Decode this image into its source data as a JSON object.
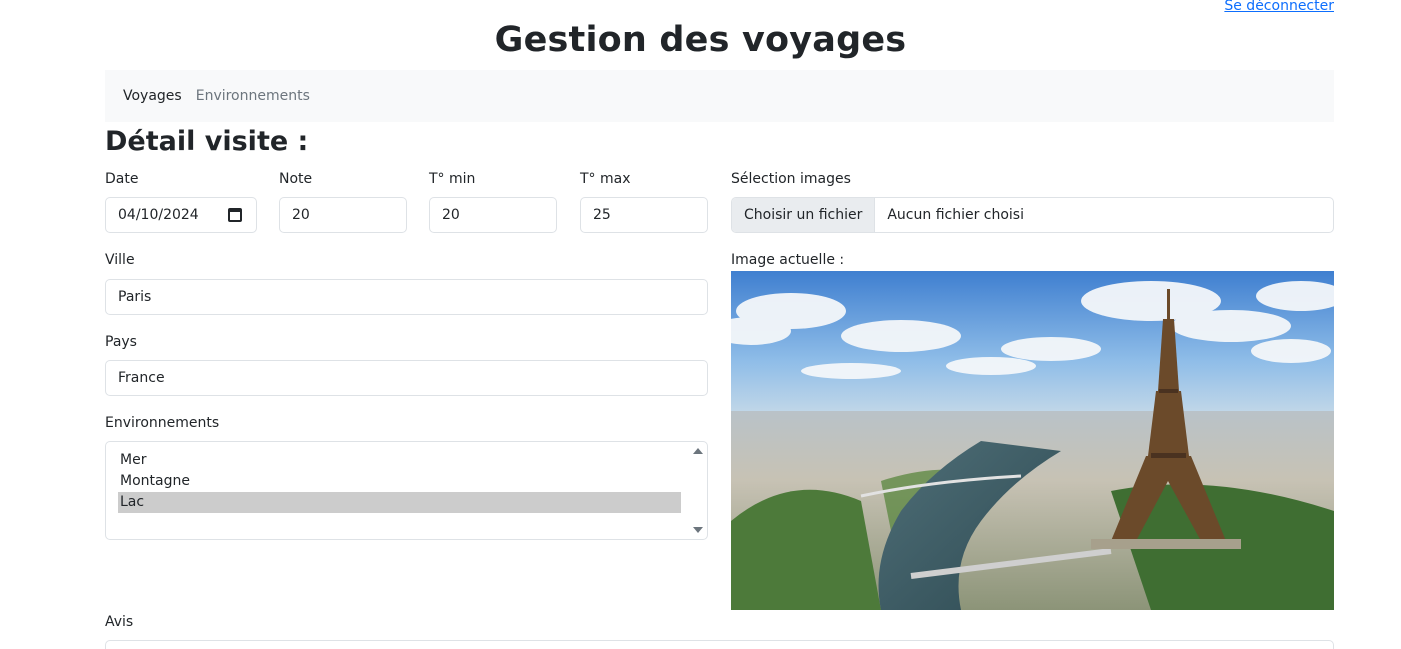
{
  "header": {
    "title": "Gestion des voyages",
    "logout_label": "Se déconnecter"
  },
  "nav": {
    "items": [
      {
        "label": "Voyages",
        "active": true
      },
      {
        "label": "Environnements",
        "active": false
      }
    ]
  },
  "form": {
    "section_title": "Détail visite :",
    "date": {
      "label": "Date",
      "value": "04/10/2024"
    },
    "note": {
      "label": "Note",
      "value": "20"
    },
    "tmin": {
      "label": "T° min",
      "value": "20"
    },
    "tmax": {
      "label": "T° max",
      "value": "25"
    },
    "ville": {
      "label": "Ville",
      "value": "Paris"
    },
    "pays": {
      "label": "Pays",
      "value": "France"
    },
    "environnements": {
      "label": "Environnements",
      "options": [
        "Mer",
        "Montagne",
        "Lac"
      ],
      "selected": "Lac"
    },
    "images": {
      "label": "Sélection images",
      "button_label": "Choisir un fichier",
      "file_status": "Aucun fichier choisi"
    },
    "current_image": {
      "label": "Image actuelle :",
      "icon": "eiffel-tower-photo"
    },
    "avis": {
      "label": "Avis"
    }
  },
  "colors": {
    "link": "#0d6efd",
    "navbar_bg": "#f8f9fa",
    "border": "#dee2e6",
    "selected_option": "#cccccc"
  }
}
